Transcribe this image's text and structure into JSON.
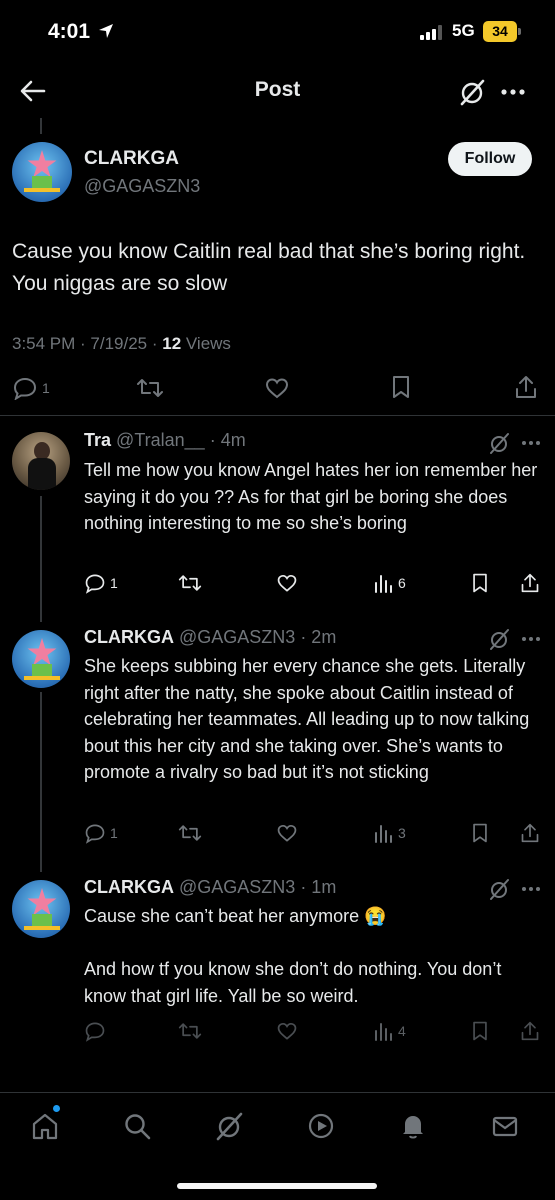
{
  "status_bar": {
    "time": "4:01",
    "network": "5G",
    "battery": "34"
  },
  "header": {
    "title": "Post"
  },
  "post": {
    "name": "CLARKGA",
    "handle": "@GAGASZN3",
    "follow_label": "Follow",
    "text": "Cause you know Caitlin real bad that she’s boring right.  You niggas are so slow",
    "timestamp": "3:54 PM · 7/19/25 · ",
    "views_count": "12",
    "views_label": " Views",
    "reply_count": "1"
  },
  "replies": [
    {
      "name": "Tra",
      "handle": "@Tralan__ · 4m",
      "text": "Tell me how you know Angel hates her ion remember her saying it do you ?? As for that girl be boring she does nothing interesting to me so she’s boring",
      "replies": "1",
      "views": "6"
    },
    {
      "name": "CLARKGA",
      "handle": "@GAGASZN3 · 2m",
      "text": "She keeps subbing her every chance she gets. Literally right after the natty, she spoke about Caitlin instead of celebrating her teammates. All leading up to now talking bout this her city and she taking over. She’s wants to promote a rivalry so bad but it’s not sticking",
      "replies": "1",
      "views": "3"
    },
    {
      "name": "CLARKGA",
      "handle": "@GAGASZN3 · 1m",
      "text_line1": "Cause she can’t beat her anymore 😭",
      "text_line2": "And how tf you know she don’t do nothing. You don’t know that girl life. Yall be so weird.",
      "replies": "",
      "views": "4"
    }
  ],
  "colors": {
    "accent": "#1d9bf0",
    "muted": "#71767b",
    "text": "#e7e9ea",
    "battery": "#f3c82a"
  }
}
